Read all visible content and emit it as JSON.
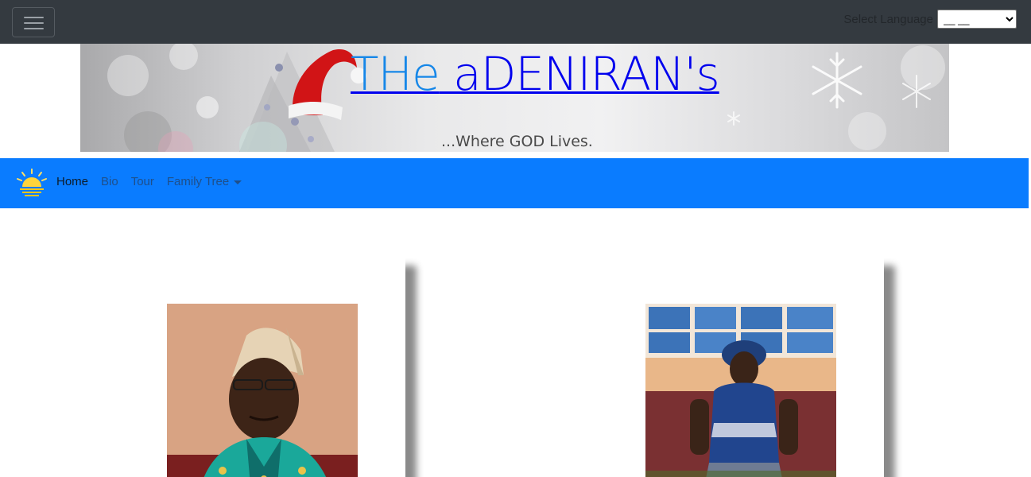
{
  "topbar": {
    "language_label": "Select Language",
    "language_selected": "__ __"
  },
  "banner": {
    "title_lead": "THe",
    "title_rest": " aDENIRAN's",
    "tagline": "...Where GOD Lives."
  },
  "nav": {
    "links": [
      {
        "label": "Home",
        "active": true
      },
      {
        "label": "Bio"
      },
      {
        "label": "Tour"
      },
      {
        "label": "Family Tree",
        "dropdown": true
      }
    ]
  },
  "colors": {
    "topbar": "#343a40",
    "nav": "#0a7cff",
    "title_link": "#0000ee"
  },
  "icons": [
    "menu-icon",
    "sun-logo-icon",
    "santa-hat-icon",
    "snowflake-icon",
    "caret-down-icon"
  ]
}
